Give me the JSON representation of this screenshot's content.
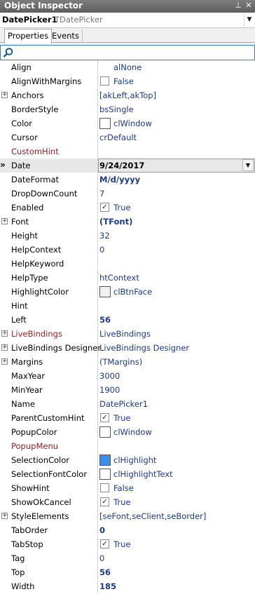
{
  "window": {
    "title": "Object Inspector"
  },
  "selector": {
    "name": "DatePicker1",
    "type": "TDatePicker"
  },
  "tabs": [
    {
      "label": "Properties"
    },
    {
      "label": "Events"
    }
  ],
  "search": {
    "value": "",
    "placeholder": ""
  },
  "colors": {
    "selection": "#3c8ce8",
    "value_text": "#1a3a8a",
    "event_text": "#9b1b1b"
  },
  "properties": [
    {
      "name": "Align",
      "value": "alNone"
    },
    {
      "name": "AlignWithMargins",
      "value": "False",
      "check": ""
    },
    {
      "name": "Anchors",
      "value": "[akLeft,akTop]",
      "expand": "+"
    },
    {
      "name": "BorderStyle",
      "value": "bsSingle"
    },
    {
      "name": "Color",
      "value": "clWindow",
      "swatch": "#ffffff"
    },
    {
      "name": "Cursor",
      "value": "crDefault"
    },
    {
      "name": "CustomHint",
      "value": "",
      "event": true
    },
    {
      "name": "Date",
      "value": "9/24/2017",
      "selected": true
    },
    {
      "name": "DateFormat",
      "value": "M/d/yyyy"
    },
    {
      "name": "DropDownCount",
      "value": "7"
    },
    {
      "name": "Enabled",
      "value": "True",
      "check": "✓"
    },
    {
      "name": "Font",
      "value": "(TFont)",
      "expand": "+"
    },
    {
      "name": "Height",
      "value": "32"
    },
    {
      "name": "HelpContext",
      "value": "0"
    },
    {
      "name": "HelpKeyword",
      "value": ""
    },
    {
      "name": "HelpType",
      "value": "htContext"
    },
    {
      "name": "HighlightColor",
      "value": "clBtnFace",
      "swatch": "#f0f0f0"
    },
    {
      "name": "Hint",
      "value": ""
    },
    {
      "name": "Left",
      "value": "56"
    },
    {
      "name": "LiveBindings",
      "value": "LiveBindings",
      "expand": "+",
      "event": true
    },
    {
      "name": "LiveBindings Designer",
      "value": "LiveBindings Designer",
      "expand": "+"
    },
    {
      "name": "Margins",
      "value": "(TMargins)",
      "expand": "+"
    },
    {
      "name": "MaxYear",
      "value": "3000"
    },
    {
      "name": "MinYear",
      "value": "1900"
    },
    {
      "name": "Name",
      "value": "DatePicker1"
    },
    {
      "name": "ParentCustomHint",
      "value": "True",
      "check": "✓"
    },
    {
      "name": "PopupColor",
      "value": "clWindow",
      "swatch": "#ffffff"
    },
    {
      "name": "PopupMenu",
      "value": "",
      "event": true
    },
    {
      "name": "SelectionColor",
      "value": "clHighlight",
      "swatch": "#3c8ce8"
    },
    {
      "name": "SelectionFontColor",
      "value": "clHighlightText",
      "swatch": "#ffffff"
    },
    {
      "name": "ShowHint",
      "value": "False",
      "check": ""
    },
    {
      "name": "ShowOkCancel",
      "value": "True",
      "check": "✓"
    },
    {
      "name": "StyleElements",
      "value": "[seFont,seClient,seBorder]",
      "expand": "+"
    },
    {
      "name": "TabOrder",
      "value": "0"
    },
    {
      "name": "TabStop",
      "value": "True",
      "check": "✓"
    },
    {
      "name": "Tag",
      "value": "0"
    },
    {
      "name": "Top",
      "value": "56"
    },
    {
      "name": "Width",
      "value": "185"
    }
  ]
}
